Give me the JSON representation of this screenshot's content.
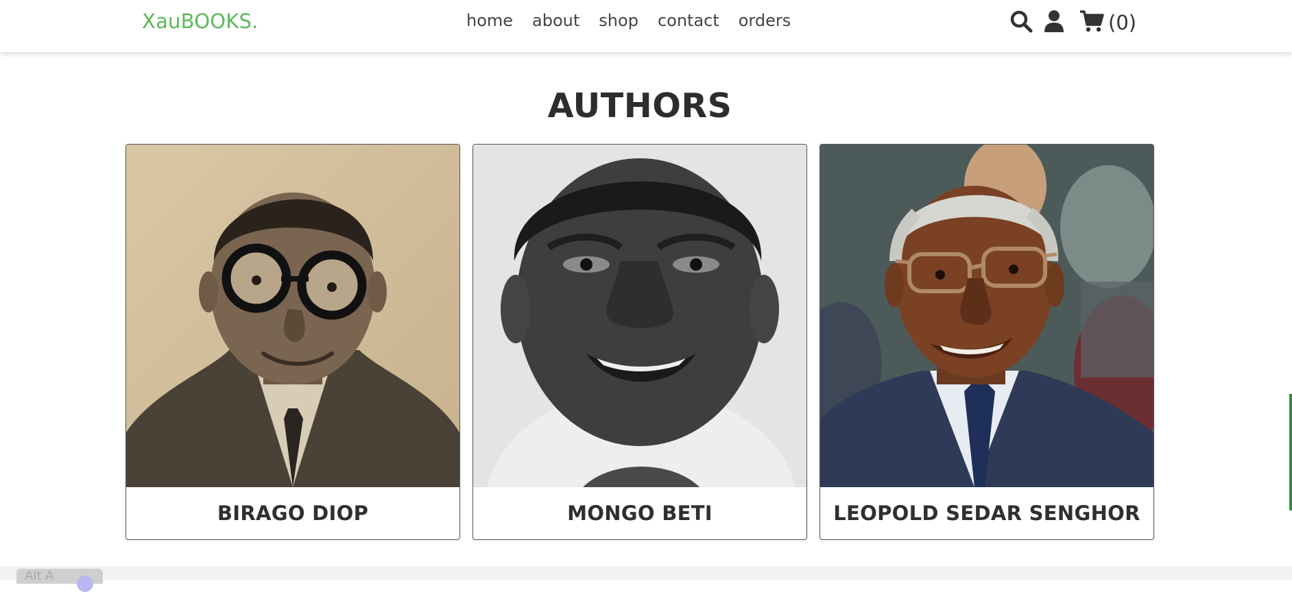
{
  "header": {
    "logo": "XauBOOKS.",
    "nav": [
      "home",
      "about",
      "shop",
      "contact",
      "orders"
    ],
    "icons": [
      "search-icon",
      "user-icon",
      "cart-icon"
    ],
    "cart_count": "(0)"
  },
  "section": {
    "title": "AUTHORS"
  },
  "authors": [
    {
      "name": "BIRAGO DIOP"
    },
    {
      "name": "MONGO BETI"
    },
    {
      "name": "LEOPOLD SEDAR SENGHOR"
    }
  ],
  "footer": {
    "badge": "Alt A"
  },
  "colors": {
    "brand": "#5cb85c",
    "text": "#333333"
  }
}
